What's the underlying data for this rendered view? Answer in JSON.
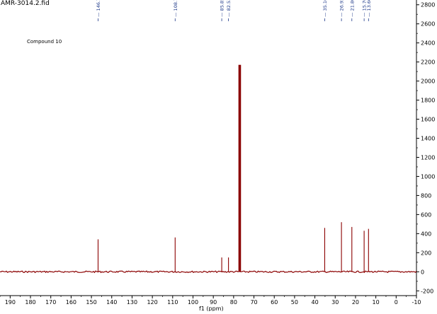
{
  "file_title": "AMR-3014.2.fid",
  "compound_label": "Compound 10",
  "chart_data": {
    "type": "line",
    "title": "AMR-3014.2.fid",
    "xlabel": "f1 (ppm)",
    "ylabel": "",
    "x_reversed": true,
    "xlim": [
      195,
      -10
    ],
    "ylim": [
      -250,
      2850
    ],
    "x_ticks": [
      190,
      180,
      170,
      160,
      150,
      140,
      130,
      120,
      110,
      100,
      90,
      80,
      70,
      60,
      50,
      40,
      30,
      20,
      10,
      0,
      -10
    ],
    "y_ticks": [
      -200,
      0,
      200,
      400,
      600,
      800,
      1000,
      1200,
      1400,
      1600,
      1800,
      2000,
      2200,
      2400,
      2600,
      2800
    ],
    "y_axis_position": "right",
    "grid": false,
    "peaks": [
      {
        "ppm": 146.72,
        "intensity": 340,
        "label": "146.72"
      },
      {
        "ppm": 108.79,
        "intensity": 360,
        "label": "108.79"
      },
      {
        "ppm": 85.85,
        "intensity": 150,
        "label": "85.85"
      },
      {
        "ppm": 82.53,
        "intensity": 150,
        "label": "82.53"
      },
      {
        "ppm": 77.0,
        "intensity": 2170,
        "label": ""
      },
      {
        "ppm": 35.16,
        "intensity": 460,
        "label": "35.16"
      },
      {
        "ppm": 26.92,
        "intensity": 520,
        "label": "26.92"
      },
      {
        "ppm": 21.8,
        "intensity": 470,
        "label": "21.80"
      },
      {
        "ppm": 15.76,
        "intensity": 430,
        "label": "15.76"
      },
      {
        "ppm": 13.6,
        "intensity": 450,
        "label": "13.60"
      }
    ],
    "colors": {
      "spectrum": "#8b0000",
      "labels": "#1f3a8a",
      "axis": "#000000"
    }
  }
}
